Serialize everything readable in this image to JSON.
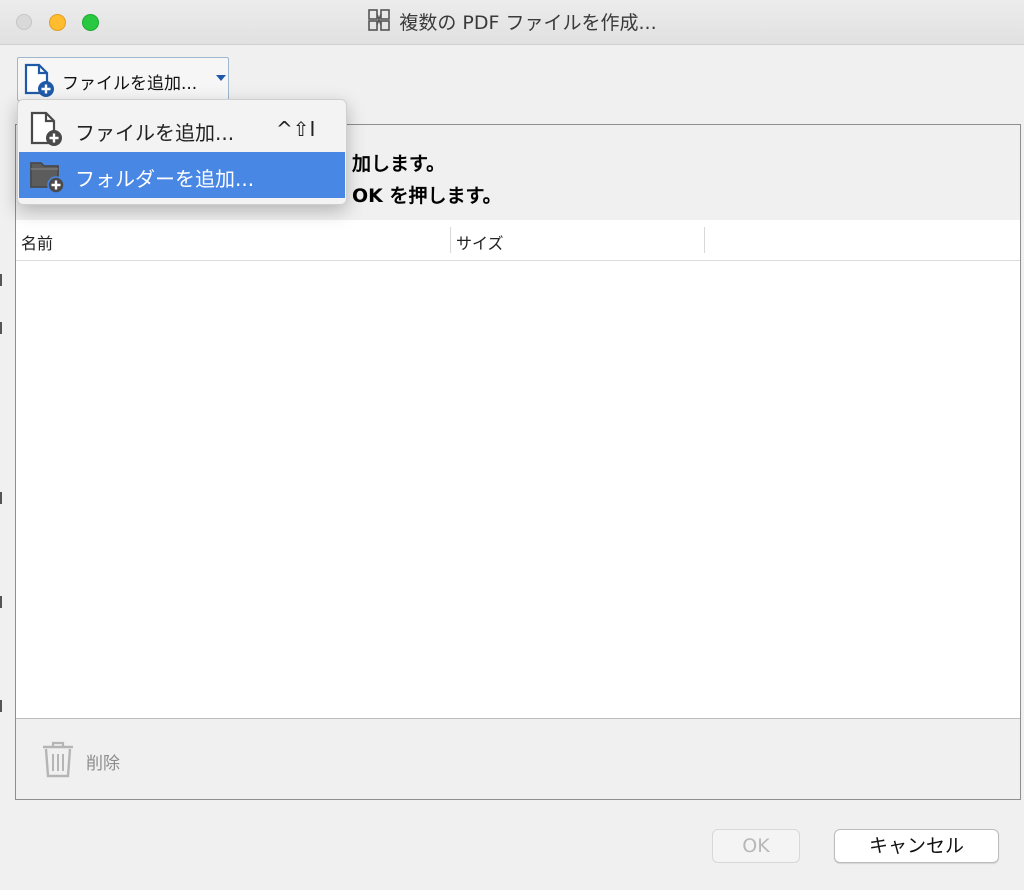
{
  "window": {
    "title": "複数の PDF ファイルを作成..."
  },
  "toolbar": {
    "add_button_label": "ファイルを追加..."
  },
  "menu": {
    "items": [
      {
        "label": "ファイルを追加...",
        "shortcut": "^⇧I"
      },
      {
        "label": "フォルダーを追加..."
      }
    ]
  },
  "instructions": {
    "line1_visible": "加します。",
    "line2_visible": "OK を押します。"
  },
  "table": {
    "columns": [
      {
        "label": "名前"
      },
      {
        "label": "サイズ"
      }
    ],
    "rows": []
  },
  "footer": {
    "delete_label": "削除"
  },
  "buttons": {
    "ok_label": "OK",
    "cancel_label": "キャンセル"
  },
  "colors": {
    "menu_highlight": "#4987e5",
    "accent_blue": "#1f5aa8"
  }
}
